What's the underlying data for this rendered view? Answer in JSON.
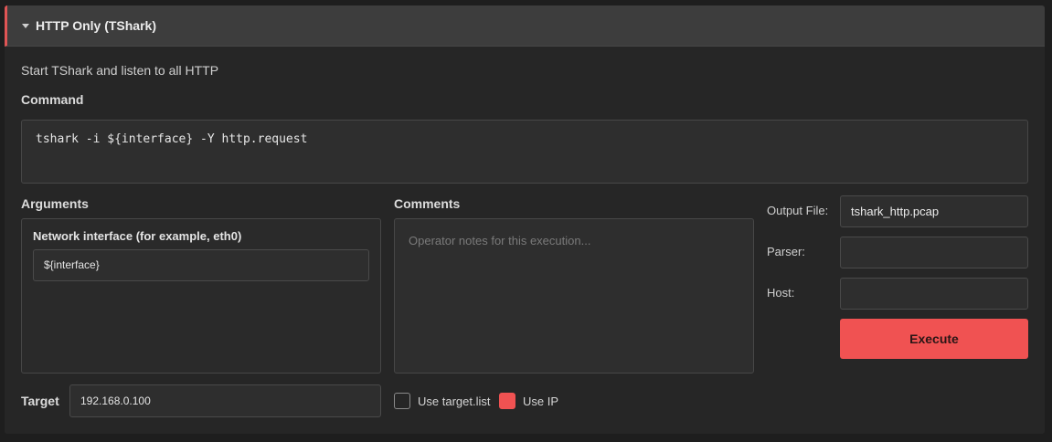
{
  "panel": {
    "title": "HTTP Only (TShark)",
    "description": "Start TShark and listen to all HTTP",
    "accent_color": "#e05555"
  },
  "command": {
    "label": "Command",
    "text": "tshark -i ${interface} -Y http.request"
  },
  "arguments": {
    "label": "Arguments",
    "items": [
      {
        "label": "Network interface (for example, eth0)",
        "value": "${interface}"
      }
    ]
  },
  "comments": {
    "label": "Comments",
    "placeholder": "Operator notes for this execution..."
  },
  "output_file": {
    "label": "Output File:",
    "value": "tshark_http.pcap"
  },
  "parser": {
    "label": "Parser:",
    "value": ""
  },
  "host": {
    "label": "Host:",
    "value": ""
  },
  "execute": {
    "label": "Execute",
    "color": "#f05252"
  },
  "target": {
    "label": "Target",
    "value": "192.168.0.100"
  },
  "use_target_list": {
    "label": "Use target.list",
    "checked": false
  },
  "use_ip": {
    "label": "Use IP",
    "checked": true
  }
}
